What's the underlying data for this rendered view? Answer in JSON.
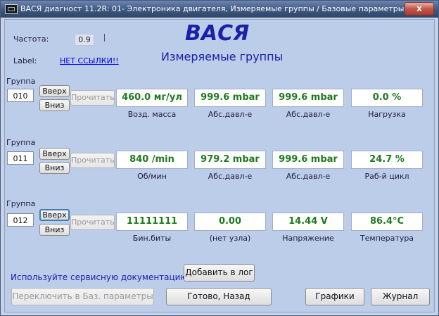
{
  "window": {
    "title": "ВАСЯ диагност 11.2R: 01- Электроника двигателя,  Измеряемые группы / Базовые параметры",
    "close": "x"
  },
  "header": {
    "freq_label": "Частота:",
    "freq_value": "0.9",
    "label_caption": "Label:",
    "label_link": "НЕТ ССЫЛКИ!!",
    "app_name": "ВАСЯ",
    "subtitle": "Измеряемые группы"
  },
  "group_label": "Группа",
  "buttons": {
    "up": "Вверх",
    "down": "Вниз",
    "read": "Прочитать"
  },
  "groups": [
    {
      "number": "010",
      "cells": [
        {
          "value": "460.0 мг/ул",
          "caption": "Возд. масса"
        },
        {
          "value": "999.6 mbar",
          "caption": "Абс.давл-е"
        },
        {
          "value": "999.6 mbar",
          "caption": "Абс.давл-е"
        },
        {
          "value": "0.0 %",
          "caption": "Нагрузка"
        }
      ]
    },
    {
      "number": "011",
      "cells": [
        {
          "value": "840 /min",
          "caption": "Об/мин"
        },
        {
          "value": "979.2 mbar",
          "caption": "Абс.давл-е"
        },
        {
          "value": "999.6 mbar",
          "caption": "Абс.давл-е"
        },
        {
          "value": "24.7 %",
          "caption": "Раб-й цикл"
        }
      ]
    },
    {
      "number": "012",
      "cells": [
        {
          "value": "11111111",
          "caption": "Бин.биты"
        },
        {
          "value": "0.00",
          "caption": "(нет узла)"
        },
        {
          "value": "14.44 V",
          "caption": "Напряжение"
        },
        {
          "value": "86.4°C",
          "caption": "Температура"
        }
      ]
    }
  ],
  "footer": {
    "note": "Используйте сервисную документацию!",
    "add_log": "Добавить в лог",
    "switch_basic": "Переключить в Баз. параметры",
    "done_back": "Готово, Назад",
    "graphs": "Графики",
    "journal": "Журнал"
  },
  "colors": {
    "value_text": "#1e7a1e",
    "title_blue": "#1a21a8",
    "background": "#bccdea"
  }
}
